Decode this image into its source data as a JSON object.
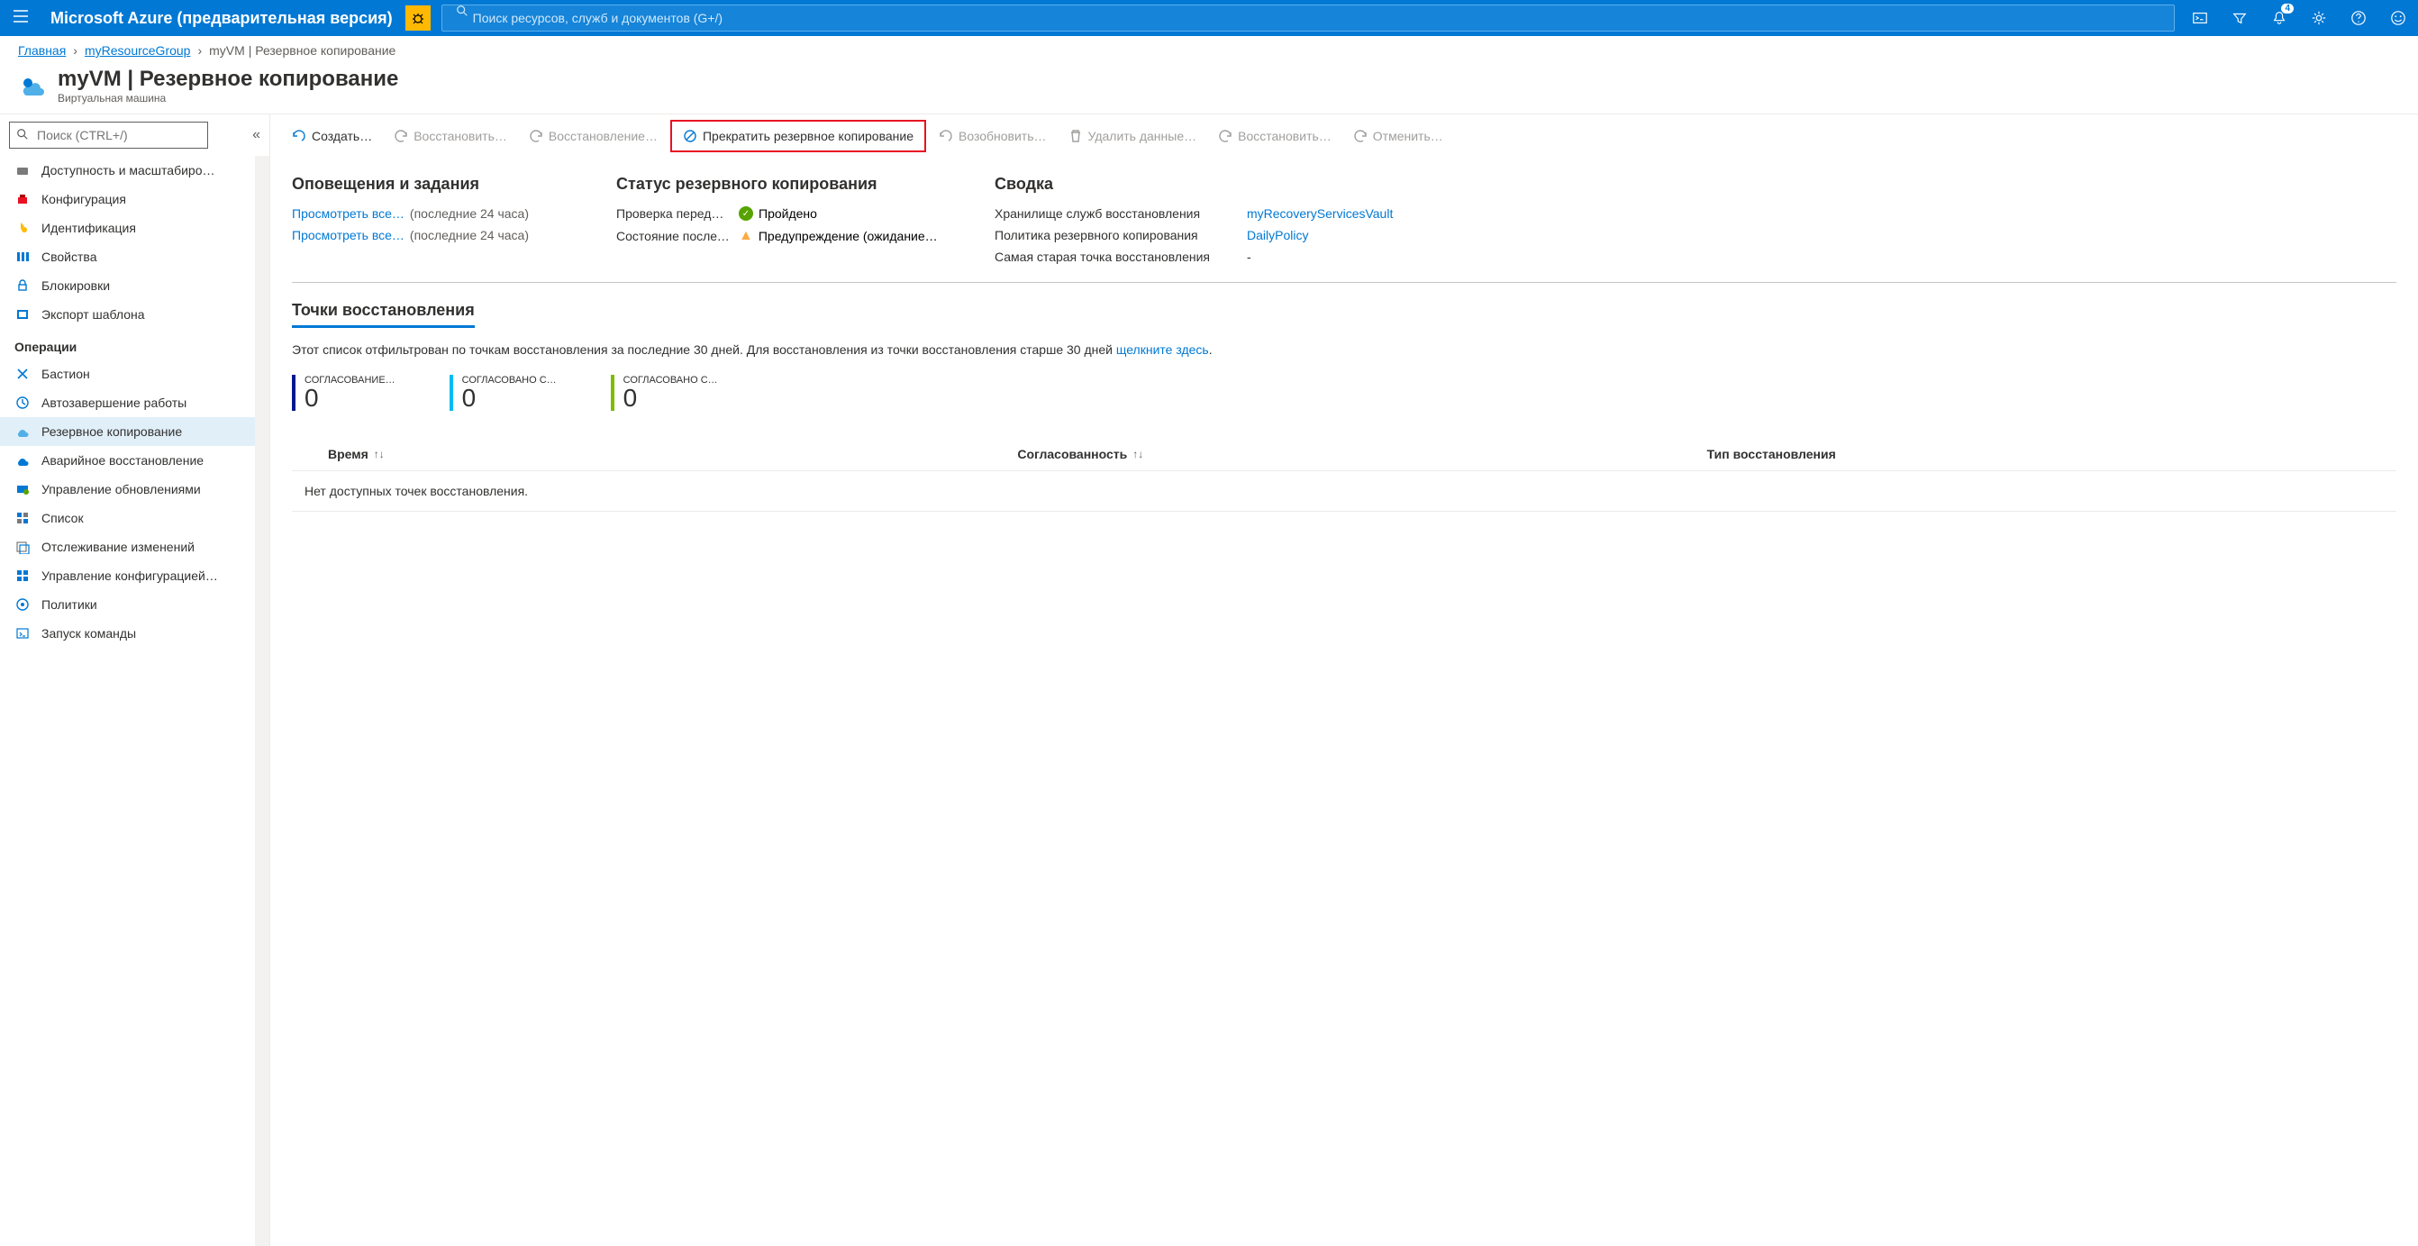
{
  "topbar": {
    "brand": "Microsoft Azure (предварительная версия)",
    "search_placeholder": "Поиск ресурсов, служб и документов (G+/)",
    "notif_count": "4"
  },
  "breadcrumb": {
    "home": "Главная",
    "rg": "myResourceGroup",
    "current": "myVM | Резервное копирование"
  },
  "page": {
    "title": "myVM | Резервное копирование",
    "subtitle": "Виртуальная машина"
  },
  "sidebar": {
    "search_placeholder": "Поиск (CTRL+/)",
    "items_top": [
      "Доступность и масштабиро…",
      "Конфигурация",
      "Идентификация",
      "Свойства",
      "Блокировки",
      "Экспорт шаблона"
    ],
    "ops_header": "Операции",
    "items_ops": [
      "Бастион",
      "Автозавершение работы",
      "Резервное копирование",
      "Аварийное восстановление",
      "Управление обновлениями",
      "Список",
      "Отслеживание изменений",
      "Управление конфигурацией…",
      "Политики",
      "Запуск команды"
    ],
    "active_index": 2
  },
  "cmdbar": {
    "create": "Создать…",
    "restore": "Восстановить…",
    "restore2": "Восстановление…",
    "stop": "Прекратить резервное копирование",
    "resume": "Возобновить…",
    "delete": "Удалить данные…",
    "restore3": "Восстановить…",
    "cancel": "Отменить…"
  },
  "panels": {
    "alerts": {
      "title": "Оповещения и задания",
      "view_all": "Просмотреть все…",
      "last24": "(последние 24 часа)"
    },
    "status": {
      "title": "Статус резервного копирования",
      "precheck_label": "Проверка перед…",
      "precheck_value": "Пройдено",
      "last_label": "Состояние послед…",
      "last_value": "Предупреждение (ожидание…"
    },
    "summary": {
      "title": "Сводка",
      "vault_k": "Хранилище служб восстановления",
      "vault_v": "myRecoveryServicesVault",
      "policy_k": "Политика резервного копирования",
      "policy_v": "DailyPolicy",
      "oldest_k": "Самая старая точка восстановления",
      "oldest_v": "-"
    }
  },
  "tabs": {
    "restore_points": "Точки восстановления"
  },
  "filter": {
    "text_a": "Этот список отфильтрован по точкам восстановления за последние 30 дней. Для восстановления из точки восстановления старше 30 дней ",
    "link": "щелкните здесь",
    "text_b": "."
  },
  "stats": [
    {
      "label": "СОГЛАСОВАНИЕ…",
      "value": "0"
    },
    {
      "label": "СОГЛАСОВАНО С…",
      "value": "0"
    },
    {
      "label": "СОГЛАСОВАНО С…",
      "value": "0"
    }
  ],
  "table": {
    "col_time": "Время",
    "col_consistency": "Согласованность",
    "col_type": "Тип восстановления",
    "empty": "Нет доступных точек восстановления."
  }
}
